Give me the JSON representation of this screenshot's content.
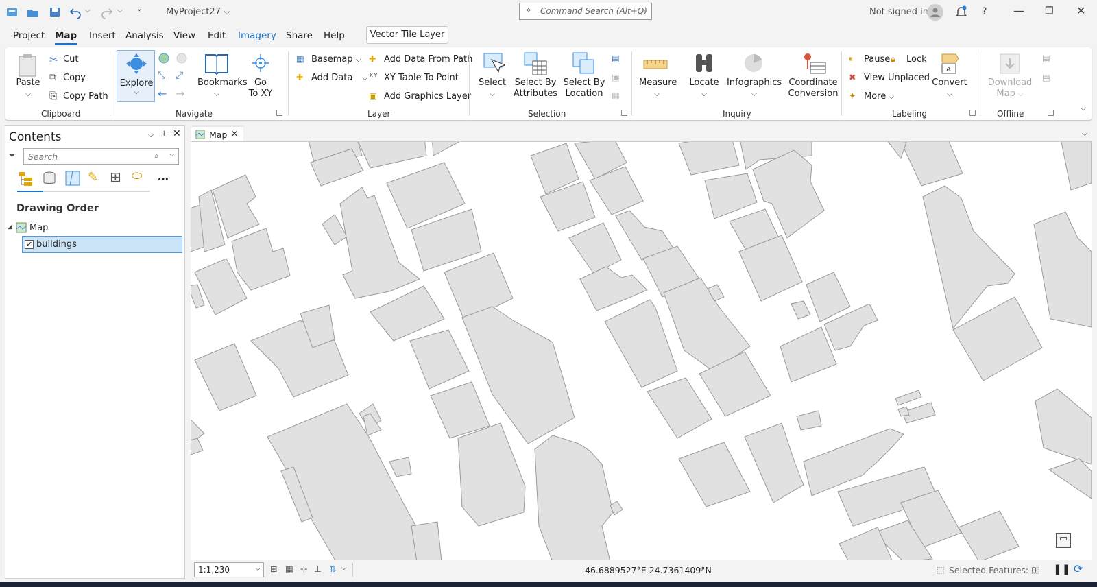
{
  "project_name": "MyProject27",
  "command_search": {
    "placeholder": "Command Search (Alt+Q)"
  },
  "account": {
    "status": "Not signed in"
  },
  "tabs": [
    "Project",
    "Map",
    "Insert",
    "Analysis",
    "View",
    "Edit",
    "Imagery",
    "Share",
    "Help"
  ],
  "active_tab": "Map",
  "contextual_tab": "Vector Tile Layer",
  "ribbon": {
    "clipboard": {
      "group": "Clipboard",
      "paste": "Paste",
      "cut": "Cut",
      "copy": "Copy",
      "copy_path": "Copy Path"
    },
    "navigate": {
      "group": "Navigate",
      "explore": "Explore",
      "bookmarks": "Bookmarks",
      "go_to_xy_1": "Go",
      "go_to_xy_2": "To XY"
    },
    "layer": {
      "group": "Layer",
      "basemap": "Basemap",
      "add_data": "Add Data",
      "add_data_from_path": "Add Data From Path",
      "xy_table": "XY Table To Point",
      "add_graphics": "Add Graphics Layer"
    },
    "selection": {
      "group": "Selection",
      "select": "Select",
      "by_attr_1": "Select By",
      "by_attr_2": "Attributes",
      "by_loc_1": "Select By",
      "by_loc_2": "Location"
    },
    "inquiry": {
      "group": "Inquiry",
      "measure": "Measure",
      "locate": "Locate",
      "infographics": "Infographics",
      "coord_1": "Coordinate",
      "coord_2": "Conversion"
    },
    "labeling": {
      "group": "Labeling",
      "pause": "Pause",
      "lock": "Lock",
      "view_unplaced": "View Unplaced",
      "more": "More",
      "convert": "Convert"
    },
    "offline": {
      "group": "Offline",
      "download_1": "Download",
      "download_2": "Map"
    }
  },
  "contents": {
    "title": "Contents",
    "search_placeholder": "Search",
    "section": "Drawing Order",
    "map_node": "Map",
    "layers": [
      {
        "name": "buildings",
        "visible": true
      }
    ]
  },
  "map_view": {
    "tab_label": "Map"
  },
  "status": {
    "scale": "1:1,230",
    "coordinates": "46.6889527°E 24.7361409°N",
    "selected_features": "Selected Features: 0"
  },
  "colors": {
    "accent": "#1a75d0",
    "building_fill": "#e1e1e1",
    "building_stroke": "#9a9a9a",
    "selection": "#cce4f7"
  }
}
